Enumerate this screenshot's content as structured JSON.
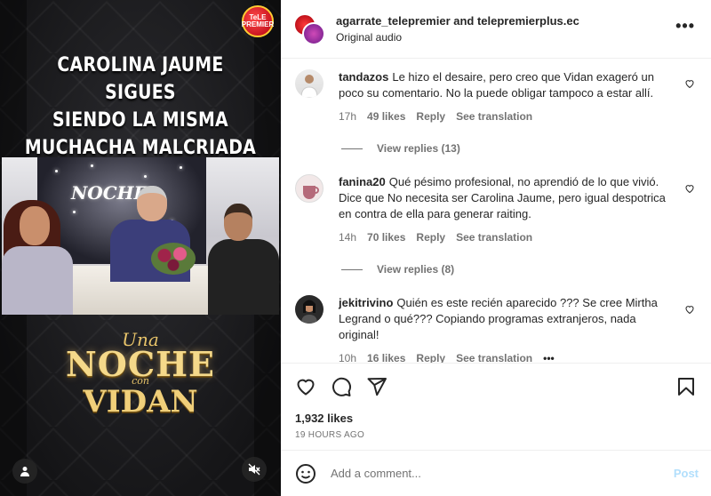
{
  "media": {
    "caption_lines": [
      "CAROLINA JAUME SIGUES",
      "SIENDO LA MISMA",
      "MUCHACHA MALCRIADA"
    ],
    "channel_logo": "TeLE PREMIER",
    "set_logo": "NOCHE",
    "show_logo": {
      "una": "Una",
      "noche": "NOCHE",
      "con": "con",
      "vidan": "VIDAN"
    },
    "icons": {
      "user_tag": "user-icon",
      "mute": "speaker-muted-icon"
    }
  },
  "header": {
    "accounts": "agarrate_telepremier and telepremierplus.ec",
    "audio": "Original audio",
    "more": "•••"
  },
  "comments": [
    {
      "user": "tandazos",
      "text": "Le hizo el desaire, pero creo que Vidan exageró un poco su comentario. No la puede obligar tampoco a estar allí.",
      "time": "17h",
      "likes": "49 likes",
      "reply": "Reply",
      "translate": "See translation",
      "view_replies": "View replies (13)"
    },
    {
      "user": "fanina20",
      "text": "Qué pésimo profesional, no aprendió de lo que vivió. Dice que No necesita ser Carolina Jaume, pero igual despotrica en contra de ella para generar raiting.",
      "time": "14h",
      "likes": "70 likes",
      "reply": "Reply",
      "translate": "See translation",
      "view_replies": "View replies (8)"
    },
    {
      "user": "jekitrivino",
      "text": "Quién es este recién aparecido ??? Se cree Mirtha Legrand o qué??? Copiando programas extranjeros, nada original!",
      "time": "10h",
      "likes": "16 likes",
      "reply": "Reply",
      "translate": "See translation",
      "more": "•••"
    }
  ],
  "actions": {
    "likes": "1,932 likes",
    "time": "19 HOURS AGO"
  },
  "composer": {
    "placeholder": "Add a comment...",
    "post_label": "Post"
  },
  "colors": {
    "link_disabled": "#b2dffc",
    "secondary_text": "#737373",
    "primary_text": "#262626"
  }
}
